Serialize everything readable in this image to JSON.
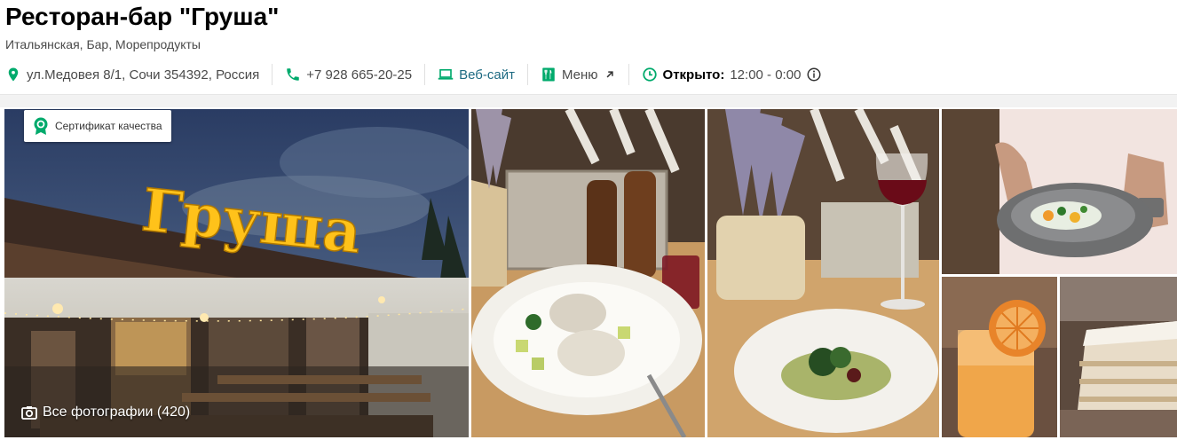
{
  "restaurant": {
    "title": "Ресторан-бар \"Груша\"",
    "cuisines": "Итальянская, Бар, Морепродукты"
  },
  "info": {
    "address": "ул.Медовея 8/1, Сочи 354392, Россия",
    "phone": "+7 928 665-20-25",
    "website": "Веб-сайт",
    "menu": "Меню",
    "status_label": "Открыто:",
    "hours": "12:00 - 0:00"
  },
  "icons": {
    "address": "map-pin-icon",
    "phone": "phone-icon",
    "website": "laptop-icon",
    "menu": "menu-book-icon",
    "external": "arrow-up-right-icon",
    "hours": "clock-icon",
    "info": "info-circle-icon",
    "certificate": "award-badge-icon",
    "camera": "camera-icon"
  },
  "gallery": {
    "certificate_label": "Сертификат качества",
    "sign_text": "Груша",
    "all_photos_label": "Все фотографии (420)"
  },
  "colors": {
    "accent_green": "#00aa6c",
    "link_blue": "#1d6a82",
    "sign_yellow": "#ffc21a"
  }
}
